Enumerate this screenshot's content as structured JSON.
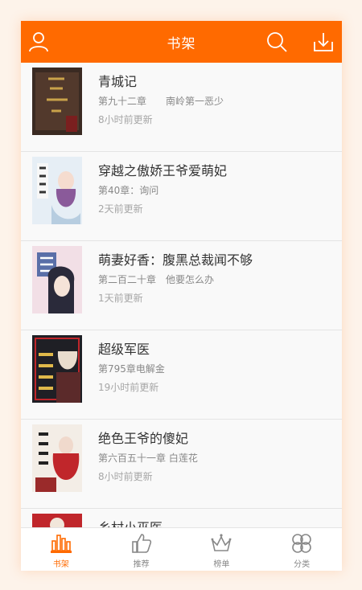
{
  "header": {
    "title": "书架",
    "left_icon": "user-icon",
    "right_icons": [
      "search-icon",
      "download-icon"
    ]
  },
  "books": [
    {
      "title": "青城记",
      "chapter": "第九十二章　　南岭第一恶少",
      "updated": "8小时前更新",
      "cover_color": "#3a2a22",
      "cover_accent": "#c9a24a"
    },
    {
      "title": "穿越之傲娇王爷爱萌妃",
      "chapter": "第40章：询问",
      "updated": "2天前更新",
      "cover_color": "#e6eef5",
      "cover_accent": "#8a5a9a"
    },
    {
      "title": "萌妻好香：腹黑总裁闻不够",
      "chapter": "第二百二十章　他要怎么办",
      "updated": "1天前更新",
      "cover_color": "#f2dfe6",
      "cover_accent": "#3b3b5a"
    },
    {
      "title": "超级军医",
      "chapter": "第795章电解金",
      "updated": "19小时前更新",
      "cover_color": "#1f1f25",
      "cover_accent": "#c0262b"
    },
    {
      "title": "绝色王爷的傻妃",
      "chapter": "第六百五十一章 白莲花",
      "updated": "8小时前更新",
      "cover_color": "#f3ede6",
      "cover_accent": "#c0262b"
    },
    {
      "title": "乡村小巫医",
      "chapter": "",
      "updated": "",
      "cover_color": "#c0262b",
      "cover_accent": "#f1e6da"
    }
  ],
  "tabs": [
    {
      "label": "书架",
      "icon": "bookshelf-icon",
      "active": true
    },
    {
      "label": "推荐",
      "icon": "thumbs-up-icon",
      "active": false
    },
    {
      "label": "榜单",
      "icon": "crown-icon",
      "active": false
    },
    {
      "label": "分类",
      "icon": "clover-icon",
      "active": false
    }
  ],
  "colors": {
    "accent": "#ff6a00",
    "tab_inactive": "#888888"
  }
}
